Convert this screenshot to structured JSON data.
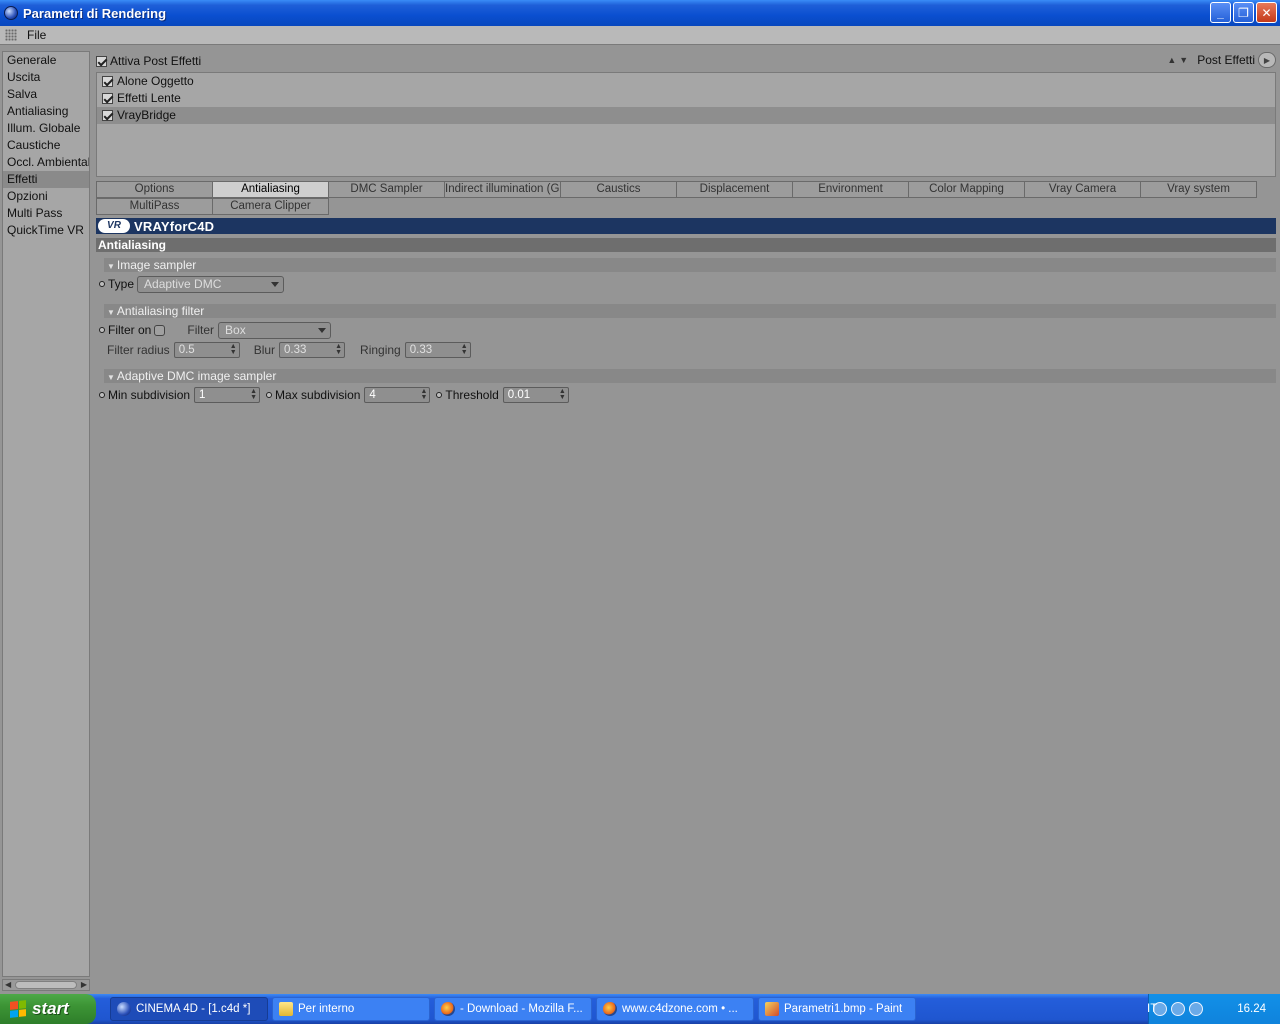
{
  "window": {
    "title": "Parametri di Rendering",
    "min": "_",
    "max": "❐",
    "close": "✕"
  },
  "menu": {
    "file": "File"
  },
  "sidebar": {
    "items": [
      "Generale",
      "Uscita",
      "Salva",
      "Antialiasing",
      "Illum. Globale",
      "Caustiche",
      "Occl. Ambientale",
      "Effetti",
      "Opzioni",
      "Multi Pass",
      "QuickTime VR"
    ],
    "active": "Effetti"
  },
  "posteffects": {
    "enable_label": "Attiva Post Effetti",
    "right_label": "Post Effetti",
    "items": [
      {
        "label": "Alone Oggetto",
        "checked": true
      },
      {
        "label": "Effetti Lente",
        "checked": true
      },
      {
        "label": "VrayBridge",
        "checked": true,
        "selected": true
      }
    ]
  },
  "tabs": {
    "row1": [
      "Options",
      "Antialiasing",
      "DMC Sampler",
      "Indirect illumination (GI)",
      "Caustics",
      "Displacement",
      "Environment",
      "Color Mapping",
      "Vray Camera",
      "Vray system"
    ],
    "row2": [
      "MultiPass",
      "Camera Clipper"
    ],
    "active": "Antialiasing"
  },
  "banner": {
    "mark": "VR",
    "text": "VRAYforC4D"
  },
  "section": {
    "title": "Antialiasing"
  },
  "image_sampler": {
    "header": "Image sampler",
    "type_label": "Type",
    "type_value": "Adaptive DMC"
  },
  "aa_filter": {
    "header": "Antialiasing filter",
    "filter_on_label": "Filter on",
    "filter_label": "Filter",
    "filter_value": "Box",
    "radius_label": "Filter radius",
    "radius_value": "0.5",
    "blur_label": "Blur",
    "blur_value": "0.33",
    "ringing_label": "Ringing",
    "ringing_value": "0.33"
  },
  "adaptive_dmc": {
    "header": "Adaptive DMC image sampler",
    "min_label": "Min subdivision",
    "min_value": "1",
    "max_label": "Max subdivision",
    "max_value": "4",
    "threshold_label": "Threshold",
    "threshold_value": "0.01"
  },
  "taskbar": {
    "start": "start",
    "tasks": [
      {
        "label": "CINEMA 4D - [1.c4d *]",
        "icon": "c4d",
        "active": true
      },
      {
        "label": "Per interno",
        "icon": "folder"
      },
      {
        "label": "- Download - Mozilla F...",
        "icon": "firefox"
      },
      {
        "label": "www.c4dzone.com • ...",
        "icon": "firefox"
      },
      {
        "label": "Parametri1.bmp - Paint",
        "icon": "paint"
      }
    ],
    "lang": "IT",
    "clock": "16.24"
  }
}
